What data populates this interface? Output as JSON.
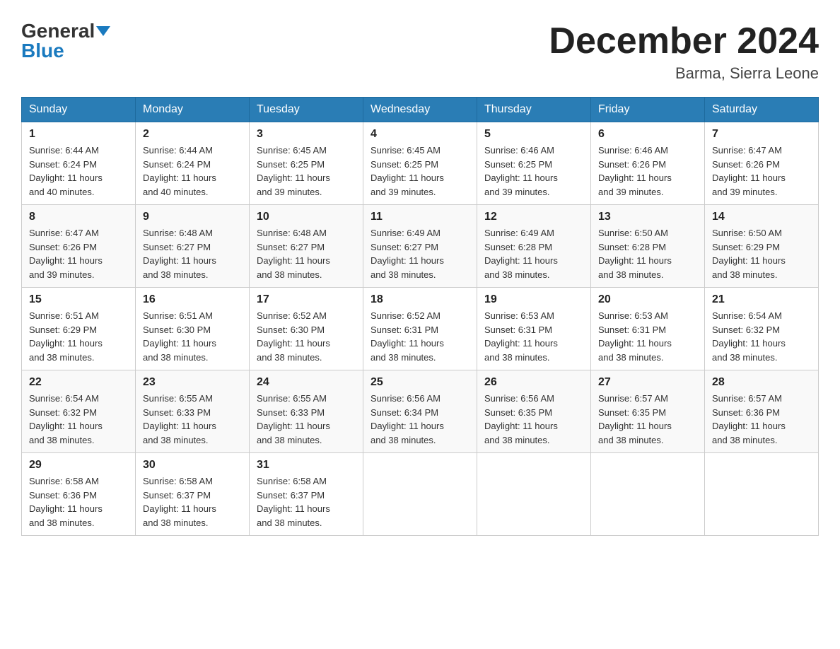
{
  "logo": {
    "general": "General",
    "blue": "Blue"
  },
  "title": {
    "month": "December 2024",
    "location": "Barma, Sierra Leone"
  },
  "headers": [
    "Sunday",
    "Monday",
    "Tuesday",
    "Wednesday",
    "Thursday",
    "Friday",
    "Saturday"
  ],
  "weeks": [
    [
      {
        "day": "1",
        "sunrise": "6:44 AM",
        "sunset": "6:24 PM",
        "daylight": "11 hours and 40 minutes."
      },
      {
        "day": "2",
        "sunrise": "6:44 AM",
        "sunset": "6:24 PM",
        "daylight": "11 hours and 40 minutes."
      },
      {
        "day": "3",
        "sunrise": "6:45 AM",
        "sunset": "6:25 PM",
        "daylight": "11 hours and 39 minutes."
      },
      {
        "day": "4",
        "sunrise": "6:45 AM",
        "sunset": "6:25 PM",
        "daylight": "11 hours and 39 minutes."
      },
      {
        "day": "5",
        "sunrise": "6:46 AM",
        "sunset": "6:25 PM",
        "daylight": "11 hours and 39 minutes."
      },
      {
        "day": "6",
        "sunrise": "6:46 AM",
        "sunset": "6:26 PM",
        "daylight": "11 hours and 39 minutes."
      },
      {
        "day": "7",
        "sunrise": "6:47 AM",
        "sunset": "6:26 PM",
        "daylight": "11 hours and 39 minutes."
      }
    ],
    [
      {
        "day": "8",
        "sunrise": "6:47 AM",
        "sunset": "6:26 PM",
        "daylight": "11 hours and 39 minutes."
      },
      {
        "day": "9",
        "sunrise": "6:48 AM",
        "sunset": "6:27 PM",
        "daylight": "11 hours and 38 minutes."
      },
      {
        "day": "10",
        "sunrise": "6:48 AM",
        "sunset": "6:27 PM",
        "daylight": "11 hours and 38 minutes."
      },
      {
        "day": "11",
        "sunrise": "6:49 AM",
        "sunset": "6:27 PM",
        "daylight": "11 hours and 38 minutes."
      },
      {
        "day": "12",
        "sunrise": "6:49 AM",
        "sunset": "6:28 PM",
        "daylight": "11 hours and 38 minutes."
      },
      {
        "day": "13",
        "sunrise": "6:50 AM",
        "sunset": "6:28 PM",
        "daylight": "11 hours and 38 minutes."
      },
      {
        "day": "14",
        "sunrise": "6:50 AM",
        "sunset": "6:29 PM",
        "daylight": "11 hours and 38 minutes."
      }
    ],
    [
      {
        "day": "15",
        "sunrise": "6:51 AM",
        "sunset": "6:29 PM",
        "daylight": "11 hours and 38 minutes."
      },
      {
        "day": "16",
        "sunrise": "6:51 AM",
        "sunset": "6:30 PM",
        "daylight": "11 hours and 38 minutes."
      },
      {
        "day": "17",
        "sunrise": "6:52 AM",
        "sunset": "6:30 PM",
        "daylight": "11 hours and 38 minutes."
      },
      {
        "day": "18",
        "sunrise": "6:52 AM",
        "sunset": "6:31 PM",
        "daylight": "11 hours and 38 minutes."
      },
      {
        "day": "19",
        "sunrise": "6:53 AM",
        "sunset": "6:31 PM",
        "daylight": "11 hours and 38 minutes."
      },
      {
        "day": "20",
        "sunrise": "6:53 AM",
        "sunset": "6:31 PM",
        "daylight": "11 hours and 38 minutes."
      },
      {
        "day": "21",
        "sunrise": "6:54 AM",
        "sunset": "6:32 PM",
        "daylight": "11 hours and 38 minutes."
      }
    ],
    [
      {
        "day": "22",
        "sunrise": "6:54 AM",
        "sunset": "6:32 PM",
        "daylight": "11 hours and 38 minutes."
      },
      {
        "day": "23",
        "sunrise": "6:55 AM",
        "sunset": "6:33 PM",
        "daylight": "11 hours and 38 minutes."
      },
      {
        "day": "24",
        "sunrise": "6:55 AM",
        "sunset": "6:33 PM",
        "daylight": "11 hours and 38 minutes."
      },
      {
        "day": "25",
        "sunrise": "6:56 AM",
        "sunset": "6:34 PM",
        "daylight": "11 hours and 38 minutes."
      },
      {
        "day": "26",
        "sunrise": "6:56 AM",
        "sunset": "6:35 PM",
        "daylight": "11 hours and 38 minutes."
      },
      {
        "day": "27",
        "sunrise": "6:57 AM",
        "sunset": "6:35 PM",
        "daylight": "11 hours and 38 minutes."
      },
      {
        "day": "28",
        "sunrise": "6:57 AM",
        "sunset": "6:36 PM",
        "daylight": "11 hours and 38 minutes."
      }
    ],
    [
      {
        "day": "29",
        "sunrise": "6:58 AM",
        "sunset": "6:36 PM",
        "daylight": "11 hours and 38 minutes."
      },
      {
        "day": "30",
        "sunrise": "6:58 AM",
        "sunset": "6:37 PM",
        "daylight": "11 hours and 38 minutes."
      },
      {
        "day": "31",
        "sunrise": "6:58 AM",
        "sunset": "6:37 PM",
        "daylight": "11 hours and 38 minutes."
      },
      null,
      null,
      null,
      null
    ]
  ],
  "labels": {
    "sunrise": "Sunrise:",
    "sunset": "Sunset:",
    "daylight": "Daylight:"
  }
}
